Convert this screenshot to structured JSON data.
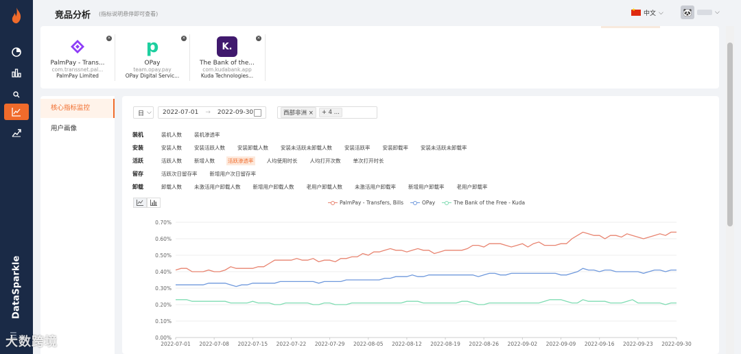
{
  "header": {
    "title": "竞品分析",
    "subtitle": "(指标说明悬停即可查看)",
    "language": "中文",
    "avatar_icon": "panda-avatar-icon"
  },
  "sidebar": {
    "brand": "DataSparkle",
    "items": [
      {
        "icon": "pie-chart-icon"
      },
      {
        "icon": "bar-chart-icon"
      },
      {
        "icon": "search-icon"
      },
      {
        "icon": "line-chart-icon",
        "active": true
      },
      {
        "icon": "trend-icon"
      }
    ]
  },
  "apps": [
    {
      "name": "PalmPay - Trans...",
      "package": "com.transsnet.pal...",
      "developer": "PalmPay Limited",
      "color": "#7b2ff7",
      "logo": "P"
    },
    {
      "name": "OPay",
      "package": "team.opay.pay",
      "developer": "OPay Digital Servic...",
      "color": "#1dcf9f",
      "logo": "p"
    },
    {
      "name": "The Bank of the...",
      "package": "com.kudabank.app",
      "developer": "Kuda Technologies...",
      "color": "#40196d",
      "logo": "K."
    }
  ],
  "left_nav": {
    "items": [
      "核心指标监控",
      "用户画像"
    ]
  },
  "filters": {
    "granularity": "日",
    "start_date": "2022-07-01",
    "end_date": "2022-09-30",
    "region_tag": "西部非洲",
    "more_tag": "+ 4 ..."
  },
  "metrics": [
    {
      "label": "装机",
      "items": [
        "装机人数",
        "装机渗透率"
      ]
    },
    {
      "label": "安装",
      "items": [
        "安装人数",
        "安装活跃人数",
        "安装卸载人数",
        "安装未活跃未卸载人数",
        "安装活跃率",
        "安装卸载率",
        "安装未活跃未卸载率"
      ]
    },
    {
      "label": "活跃",
      "items": [
        "活跃人数",
        "新增人数",
        "活跃渗透率",
        "人均使用时长",
        "人均打开次数",
        "单次打开时长"
      ],
      "active": "活跃渗透率"
    },
    {
      "label": "留存",
      "items": [
        "活跃次日留存率",
        "新增用户次日留存率"
      ]
    },
    {
      "label": "卸载",
      "items": [
        "卸载人数",
        "未激活用户卸载人数",
        "新增用户卸载人数",
        "老用户卸载人数",
        "未激活用户卸载率",
        "新增用户卸载率",
        "老用户卸载率"
      ]
    }
  ],
  "chart_data": {
    "type": "line",
    "x": [
      "2022-07-01",
      "2022-07-02",
      "2022-07-03",
      "2022-07-04",
      "2022-07-05",
      "2022-07-06",
      "2022-07-07",
      "2022-07-08",
      "2022-07-09",
      "2022-07-10",
      "2022-07-11",
      "2022-07-12",
      "2022-07-13",
      "2022-07-14",
      "2022-07-15",
      "2022-07-16",
      "2022-07-17",
      "2022-07-18",
      "2022-07-19",
      "2022-07-20",
      "2022-07-21",
      "2022-07-22",
      "2022-07-23",
      "2022-07-24",
      "2022-07-25",
      "2022-07-26",
      "2022-07-27",
      "2022-07-28",
      "2022-07-29",
      "2022-07-30",
      "2022-07-31",
      "2022-08-01",
      "2022-08-02",
      "2022-08-03",
      "2022-08-04",
      "2022-08-05",
      "2022-08-06",
      "2022-08-07",
      "2022-08-08",
      "2022-08-09",
      "2022-08-10",
      "2022-08-11",
      "2022-08-12",
      "2022-08-13",
      "2022-08-14",
      "2022-08-15",
      "2022-08-16",
      "2022-08-17",
      "2022-08-18",
      "2022-08-19",
      "2022-08-20",
      "2022-08-21",
      "2022-08-22",
      "2022-08-23",
      "2022-08-24",
      "2022-08-25",
      "2022-08-26",
      "2022-08-27",
      "2022-08-28",
      "2022-08-29",
      "2022-08-30",
      "2022-08-31",
      "2022-09-01",
      "2022-09-02",
      "2022-09-03",
      "2022-09-04",
      "2022-09-05",
      "2022-09-06",
      "2022-09-07",
      "2022-09-08",
      "2022-09-09",
      "2022-09-10",
      "2022-09-11",
      "2022-09-12",
      "2022-09-13",
      "2022-09-14",
      "2022-09-15",
      "2022-09-16",
      "2022-09-17",
      "2022-09-18",
      "2022-09-19",
      "2022-09-20",
      "2022-09-21",
      "2022-09-22",
      "2022-09-23",
      "2022-09-24",
      "2022-09-25",
      "2022-09-26",
      "2022-09-27",
      "2022-09-28",
      "2022-09-29",
      "2022-09-30"
    ],
    "tick_labels": [
      "2022-07-01",
      "2022-07-08",
      "2022-07-15",
      "2022-07-22",
      "2022-07-29",
      "2022-08-05",
      "2022-08-12",
      "2022-08-19",
      "2022-08-26",
      "2022-09-02",
      "2022-09-09",
      "2022-09-16",
      "2022-09-23",
      "2022-09-30"
    ],
    "y_ticks": [
      "0.00%",
      "0.10%",
      "0.20%",
      "0.30%",
      "0.40%",
      "0.50%",
      "0.60%",
      "0.70%"
    ],
    "ylim": [
      0,
      0.7
    ],
    "grid": true,
    "legend_position": "top-center",
    "series": [
      {
        "name": "PalmPay - Transfers, Bills",
        "color": "#e8836f",
        "values": [
          0.41,
          0.42,
          0.42,
          0.4,
          0.4,
          0.4,
          0.41,
          0.4,
          0.4,
          0.41,
          0.43,
          0.42,
          0.42,
          0.42,
          0.42,
          0.43,
          0.43,
          0.45,
          0.47,
          0.47,
          0.47,
          0.47,
          0.48,
          0.47,
          0.47,
          0.48,
          0.46,
          0.47,
          0.47,
          0.46,
          0.48,
          0.48,
          0.49,
          0.49,
          0.51,
          0.5,
          0.52,
          0.52,
          0.53,
          0.54,
          0.53,
          0.53,
          0.52,
          0.53,
          0.54,
          0.53,
          0.53,
          0.51,
          0.52,
          0.53,
          0.53,
          0.53,
          0.53,
          0.54,
          0.56,
          0.56,
          0.55,
          0.57,
          0.57,
          0.57,
          0.56,
          0.55,
          0.56,
          0.57,
          0.55,
          0.57,
          0.58,
          0.56,
          0.56,
          0.56,
          0.57,
          0.57,
          0.6,
          0.62,
          0.64,
          0.63,
          0.62,
          0.62,
          0.6,
          0.62,
          0.62,
          0.61,
          0.63,
          0.62,
          0.61,
          0.6,
          0.61,
          0.62,
          0.63,
          0.62,
          0.64,
          0.64
        ]
      },
      {
        "name": "OPay",
        "color": "#6e98dc",
        "values": [
          0.32,
          0.32,
          0.32,
          0.32,
          0.32,
          0.32,
          0.33,
          0.33,
          0.33,
          0.33,
          0.32,
          0.31,
          0.32,
          0.32,
          0.33,
          0.33,
          0.33,
          0.33,
          0.33,
          0.34,
          0.34,
          0.34,
          0.34,
          0.34,
          0.34,
          0.34,
          0.33,
          0.34,
          0.34,
          0.34,
          0.34,
          0.35,
          0.35,
          0.35,
          0.35,
          0.35,
          0.35,
          0.35,
          0.36,
          0.36,
          0.37,
          0.37,
          0.37,
          0.38,
          0.37,
          0.37,
          0.38,
          0.38,
          0.38,
          0.38,
          0.38,
          0.38,
          0.38,
          0.38,
          0.38,
          0.37,
          0.38,
          0.39,
          0.39,
          0.38,
          0.38,
          0.39,
          0.39,
          0.39,
          0.39,
          0.39,
          0.39,
          0.39,
          0.39,
          0.39,
          0.38,
          0.38,
          0.39,
          0.4,
          0.42,
          0.41,
          0.41,
          0.4,
          0.41,
          0.41,
          0.4,
          0.4,
          0.4,
          0.4,
          0.4,
          0.39,
          0.4,
          0.41,
          0.41,
          0.4,
          0.41,
          0.41
        ]
      },
      {
        "name": "The Bank of the Free - Kuda",
        "color": "#7fdcb2",
        "values": [
          0.23,
          0.23,
          0.23,
          0.22,
          0.22,
          0.22,
          0.22,
          0.22,
          0.22,
          0.22,
          0.21,
          0.21,
          0.21,
          0.21,
          0.22,
          0.21,
          0.21,
          0.21,
          0.2,
          0.2,
          0.21,
          0.21,
          0.21,
          0.21,
          0.21,
          0.2,
          0.2,
          0.21,
          0.21,
          0.2,
          0.2,
          0.2,
          0.21,
          0.21,
          0.21,
          0.21,
          0.21,
          0.21,
          0.21,
          0.21,
          0.21,
          0.21,
          0.22,
          0.22,
          0.22,
          0.21,
          0.21,
          0.21,
          0.21,
          0.21,
          0.21,
          0.21,
          0.22,
          0.22,
          0.21,
          0.2,
          0.2,
          0.21,
          0.21,
          0.21,
          0.21,
          0.21,
          0.21,
          0.21,
          0.21,
          0.21,
          0.21,
          0.22,
          0.23,
          0.23,
          0.23,
          0.22,
          0.21,
          0.21,
          0.23,
          0.22,
          0.22,
          0.22,
          0.22,
          0.21,
          0.21,
          0.21,
          0.22,
          0.23,
          0.21,
          0.21,
          0.21,
          0.21,
          0.21,
          0.2,
          0.21,
          0.21
        ]
      }
    ]
  },
  "watermark": "大数跨境"
}
